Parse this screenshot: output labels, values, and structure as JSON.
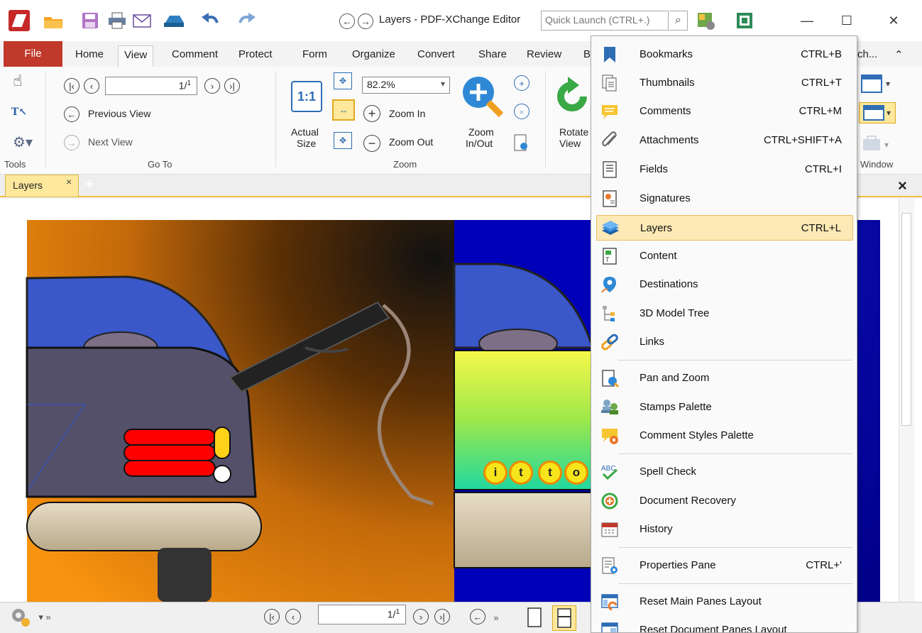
{
  "window": {
    "title": "Layers - PDF-XChange Editor",
    "quick_launch_placeholder": "Quick Launch (CTRL+.)",
    "minimize": "—",
    "maximize": "☐",
    "close": "✕"
  },
  "ribbon_tabs": [
    "File",
    "Home",
    "View",
    "Comment",
    "Protect",
    "Form",
    "Organize",
    "Convert",
    "Share",
    "Review",
    "B",
    "ch..."
  ],
  "ribbon": {
    "tools_label": "Tools",
    "goto": {
      "page_value": "1/",
      "page_total_sup": "1",
      "previous_view": "Previous View",
      "next_view": "Next View",
      "group_label": "Go To"
    },
    "zoom": {
      "actual_size_top": "Actual",
      "actual_size_bottom": "Size",
      "actual_icon": "1:1",
      "zoom_value": "82.2%",
      "zoom_in": "Zoom In",
      "zoom_out": "Zoom Out",
      "zoom_inout_top": "Zoom",
      "zoom_inout_bottom": "In/Out",
      "group_label": "Zoom"
    },
    "rotate_top": "Rotate",
    "rotate_bottom": "View",
    "window_label": "Window"
  },
  "pane": {
    "tab_label": "Layers",
    "tab_close": "×",
    "add": "+",
    "close": "×"
  },
  "document": {
    "badge_letters": [
      "i",
      "t",
      "t",
      "o"
    ]
  },
  "status": {
    "page_value": "1/",
    "page_total_sup": "1"
  },
  "menu": {
    "items": [
      {
        "label": "Bookmarks",
        "shortcut": "CTRL+B",
        "icon": "bookmark-icon"
      },
      {
        "label": "Thumbnails",
        "shortcut": "CTRL+T",
        "icon": "thumbnails-icon"
      },
      {
        "label": "Comments",
        "shortcut": "CTRL+M",
        "icon": "comments-icon"
      },
      {
        "label": "Attachments",
        "shortcut": "CTRL+SHIFT+A",
        "icon": "paperclip-icon"
      },
      {
        "label": "Fields",
        "shortcut": "CTRL+I",
        "icon": "fields-icon"
      },
      {
        "label": "Signatures",
        "shortcut": "",
        "icon": "signatures-icon"
      },
      {
        "label": "Layers",
        "shortcut": "CTRL+L",
        "icon": "layers-icon"
      },
      {
        "label": "Content",
        "shortcut": "",
        "icon": "content-icon"
      },
      {
        "label": "Destinations",
        "shortcut": "",
        "icon": "destinations-icon"
      },
      {
        "label": "3D Model Tree",
        "shortcut": "",
        "icon": "model-tree-icon"
      },
      {
        "label": "Links",
        "shortcut": "",
        "icon": "links-icon"
      },
      {
        "label": "Pan and Zoom",
        "shortcut": "",
        "icon": "pan-zoom-icon"
      },
      {
        "label": "Stamps Palette",
        "shortcut": "",
        "icon": "stamps-icon"
      },
      {
        "label": "Comment Styles Palette",
        "shortcut": "",
        "icon": "comment-styles-icon"
      },
      {
        "label": "Spell Check",
        "shortcut": "",
        "icon": "spell-check-icon"
      },
      {
        "label": "Document Recovery",
        "shortcut": "",
        "icon": "recovery-icon"
      },
      {
        "label": "History",
        "shortcut": "",
        "icon": "history-icon"
      },
      {
        "label": "Properties Pane",
        "shortcut": "CTRL+'",
        "icon": "properties-icon"
      },
      {
        "label": "Reset Main Panes Layout",
        "shortcut": "",
        "icon": "reset-main-icon"
      },
      {
        "label": "Reset Document Panes Layout",
        "shortcut": "",
        "icon": "reset-document-icon"
      }
    ],
    "highlighted": "Layers"
  },
  "colors": {
    "file_tab": "#c0392b",
    "highlight": "#fde9b5",
    "pane_tab": "#fde89c"
  }
}
